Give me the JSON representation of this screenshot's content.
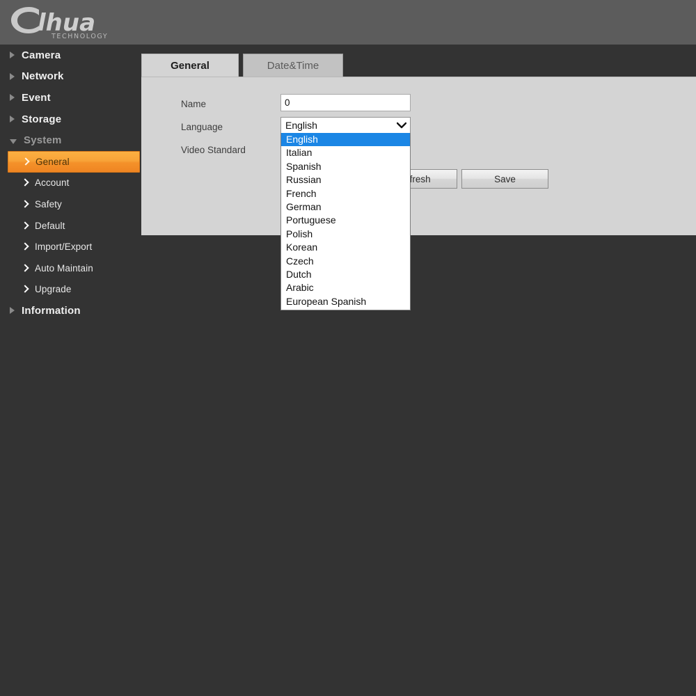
{
  "header": {
    "brand": "alhua",
    "brand_sub": "TECHNOLOGY"
  },
  "sidebar": {
    "top_items": [
      {
        "label": "Camera",
        "expanded": false
      },
      {
        "label": "Network",
        "expanded": false
      },
      {
        "label": "Event",
        "expanded": false
      },
      {
        "label": "Storage",
        "expanded": false
      },
      {
        "label": "System",
        "expanded": true
      }
    ],
    "system_children": [
      {
        "label": "General",
        "active": true
      },
      {
        "label": "Account",
        "active": false
      },
      {
        "label": "Safety",
        "active": false
      },
      {
        "label": "Default",
        "active": false
      },
      {
        "label": "Import/Export",
        "active": false
      },
      {
        "label": "Auto Maintain",
        "active": false
      },
      {
        "label": "Upgrade",
        "active": false
      }
    ],
    "trailing_item": {
      "label": "Information",
      "expanded": false
    }
  },
  "tabs": [
    {
      "label": "General",
      "active": true
    },
    {
      "label": "Date&Time",
      "active": false
    }
  ],
  "form": {
    "name_label": "Name",
    "name_value": "0",
    "language_label": "Language",
    "language_value": "English",
    "video_standard_label": "Video Standard"
  },
  "language_options": [
    "English",
    "Italian",
    "Spanish",
    "Russian",
    "French",
    "German",
    "Portuguese",
    "Polish",
    "Korean",
    "Czech",
    "Dutch",
    "Arabic",
    "European Spanish"
  ],
  "language_selected_index": 0,
  "buttons": {
    "refresh_label": "Refresh",
    "save_label": "Save"
  },
  "colors": {
    "header_band": "#5c5c5c",
    "page_background": "#333333",
    "panel_background": "#d4d4d4",
    "accent_orange": "#f4912a",
    "dropdown_highlight": "#1b86e5"
  }
}
